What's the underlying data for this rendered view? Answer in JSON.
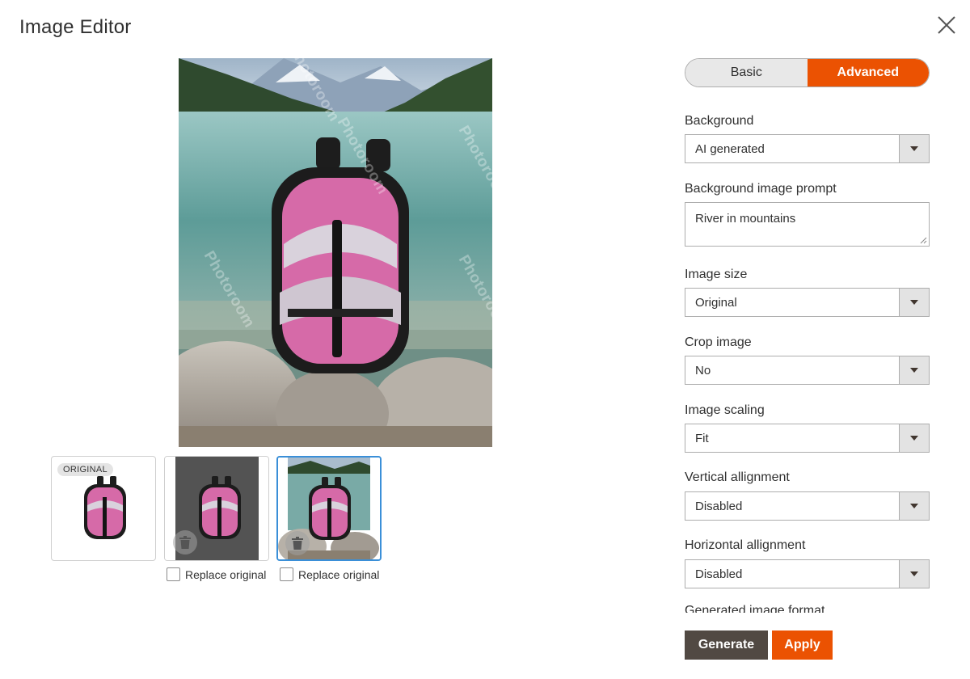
{
  "dialog": {
    "title": "Image Editor",
    "close_icon": "close-icon"
  },
  "preview": {
    "watermark_text": "Photoroom",
    "description_hidden": true
  },
  "thumbnails": [
    {
      "badge": "ORIGINAL",
      "has_trash": false,
      "selected": false
    },
    {
      "has_trash": true,
      "selected": false,
      "replace_label": "Replace original"
    },
    {
      "has_trash": true,
      "selected": true,
      "replace_label": "Replace original"
    }
  ],
  "mode_toggle": {
    "basic": "Basic",
    "advanced": "Advanced",
    "active": "Advanced"
  },
  "fields": {
    "background": {
      "label": "Background",
      "value": "AI generated"
    },
    "prompt": {
      "label": "Background image prompt",
      "value": "River in mountains"
    },
    "image_size": {
      "label": "Image size",
      "value": "Original"
    },
    "crop": {
      "label": "Crop image",
      "value": "No"
    },
    "scaling": {
      "label": "Image scaling",
      "value": "Fit"
    },
    "vertical": {
      "label": "Vertical allignment",
      "value": "Disabled"
    },
    "horizontal": {
      "label": "Horizontal allignment",
      "value": "Disabled"
    },
    "format": {
      "label": "Generated image format"
    }
  },
  "actions": {
    "generate": "Generate",
    "apply": "Apply"
  },
  "colors": {
    "accent": "#eb5202",
    "dark_button": "#514943",
    "selected_border": "#3a8fd8"
  }
}
